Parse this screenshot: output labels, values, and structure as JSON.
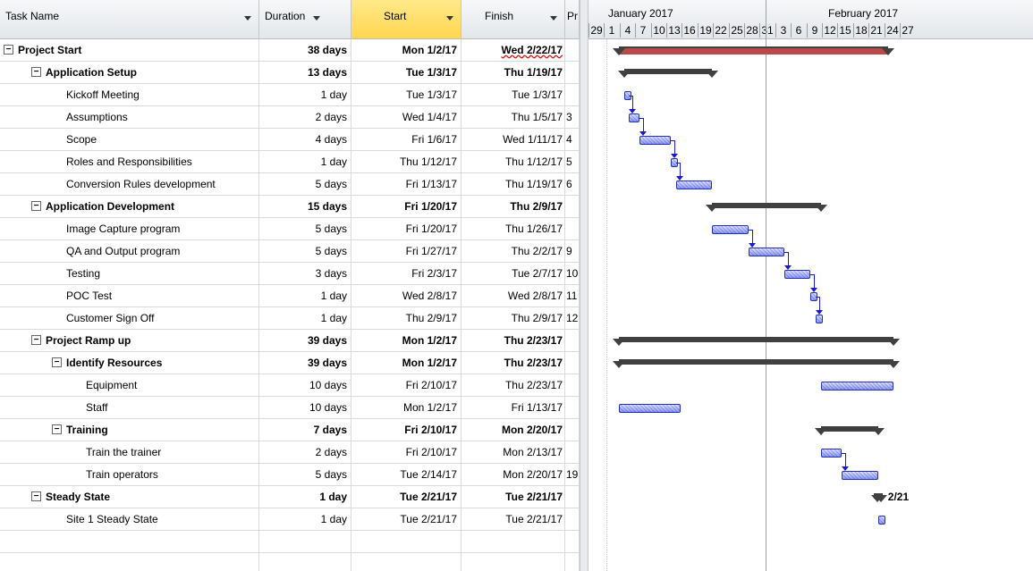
{
  "columns": {
    "task_name": "Task Name",
    "duration": "Duration",
    "start": "Start",
    "finish": "Finish",
    "predecessors": "Pr"
  },
  "timescale": {
    "months": [
      "January 2017",
      "February 2017"
    ],
    "days": [
      "29",
      "1",
      "4",
      "7",
      "10",
      "13",
      "16",
      "19",
      "22",
      "25",
      "28",
      "31",
      "3",
      "6",
      "9",
      "12",
      "15",
      "18",
      "21",
      "24",
      "27"
    ]
  },
  "tasks": [
    {
      "name": "Project Start",
      "duration": "38 days",
      "start": "Mon 1/2/17",
      "finish": "Wed 2/22/17",
      "pred": "",
      "level": 0,
      "summary": true
    },
    {
      "name": "Application Setup",
      "duration": "13 days",
      "start": "Tue 1/3/17",
      "finish": "Thu 1/19/17",
      "pred": "",
      "level": 1,
      "summary": true
    },
    {
      "name": "Kickoff Meeting",
      "duration": "1 day",
      "start": "Tue 1/3/17",
      "finish": "Tue 1/3/17",
      "pred": "",
      "level": 2,
      "summary": false
    },
    {
      "name": "Assumptions",
      "duration": "2 days",
      "start": "Wed 1/4/17",
      "finish": "Thu 1/5/17",
      "pred": "3",
      "level": 2,
      "summary": false
    },
    {
      "name": "Scope",
      "duration": "4 days",
      "start": "Fri 1/6/17",
      "finish": "Wed 1/11/17",
      "pred": "4",
      "level": 2,
      "summary": false
    },
    {
      "name": "Roles and Responsibilities",
      "duration": "1 day",
      "start": "Thu 1/12/17",
      "finish": "Thu 1/12/17",
      "pred": "5",
      "level": 2,
      "summary": false
    },
    {
      "name": "Conversion Rules development",
      "duration": "5 days",
      "start": "Fri 1/13/17",
      "finish": "Thu 1/19/17",
      "pred": "6",
      "level": 2,
      "summary": false
    },
    {
      "name": "Application Development",
      "duration": "15 days",
      "start": "Fri 1/20/17",
      "finish": "Thu 2/9/17",
      "pred": "",
      "level": 1,
      "summary": true
    },
    {
      "name": "Image Capture program",
      "duration": "5 days",
      "start": "Fri 1/20/17",
      "finish": "Thu 1/26/17",
      "pred": "",
      "level": 2,
      "summary": false
    },
    {
      "name": "QA and Output program",
      "duration": "5 days",
      "start": "Fri 1/27/17",
      "finish": "Thu 2/2/17",
      "pred": "9",
      "level": 2,
      "summary": false
    },
    {
      "name": "Testing",
      "duration": "3 days",
      "start": "Fri 2/3/17",
      "finish": "Tue 2/7/17",
      "pred": "10",
      "level": 2,
      "summary": false
    },
    {
      "name": "POC Test",
      "duration": "1 day",
      "start": "Wed 2/8/17",
      "finish": "Wed 2/8/17",
      "pred": "11",
      "level": 2,
      "summary": false
    },
    {
      "name": "Customer Sign Off",
      "duration": "1 day",
      "start": "Thu 2/9/17",
      "finish": "Thu 2/9/17",
      "pred": "12",
      "level": 2,
      "summary": false
    },
    {
      "name": "Project Ramp up",
      "duration": "39 days",
      "start": "Mon 1/2/17",
      "finish": "Thu 2/23/17",
      "pred": "",
      "level": 1,
      "summary": true
    },
    {
      "name": "Identify Resources",
      "duration": "39 days",
      "start": "Mon 1/2/17",
      "finish": "Thu 2/23/17",
      "pred": "",
      "level": 2,
      "summary": true
    },
    {
      "name": "Equipment",
      "duration": "10 days",
      "start": "Fri 2/10/17",
      "finish": "Thu 2/23/17",
      "pred": "",
      "level": 3,
      "summary": false
    },
    {
      "name": "Staff",
      "duration": "10 days",
      "start": "Mon 1/2/17",
      "finish": "Fri 1/13/17",
      "pred": "",
      "level": 3,
      "summary": false
    },
    {
      "name": "Training",
      "duration": "7 days",
      "start": "Fri 2/10/17",
      "finish": "Mon 2/20/17",
      "pred": "",
      "level": 2,
      "summary": true
    },
    {
      "name": "Train the trainer",
      "duration": "2 days",
      "start": "Fri 2/10/17",
      "finish": "Mon 2/13/17",
      "pred": "",
      "level": 3,
      "summary": false
    },
    {
      "name": "Train operators",
      "duration": "5 days",
      "start": "Tue 2/14/17",
      "finish": "Mon 2/20/17",
      "pred": "19",
      "level": 3,
      "summary": false
    },
    {
      "name": "Steady State",
      "duration": "1 day",
      "start": "Tue 2/21/17",
      "finish": "Tue 2/21/17",
      "pred": "",
      "level": 1,
      "summary": true
    },
    {
      "name": "Site 1 Steady State",
      "duration": "1 day",
      "start": "Tue 2/21/17",
      "finish": "Tue 2/21/17",
      "pred": "",
      "level": 2,
      "summary": false
    }
  ],
  "milestone_label": "2/21",
  "colors": {
    "task_bar": "#7f8ff0",
    "summary_bar": "#404040",
    "critical": "#b84a4a",
    "link": "#1a1acc",
    "selected_header": "#ffd64f"
  }
}
